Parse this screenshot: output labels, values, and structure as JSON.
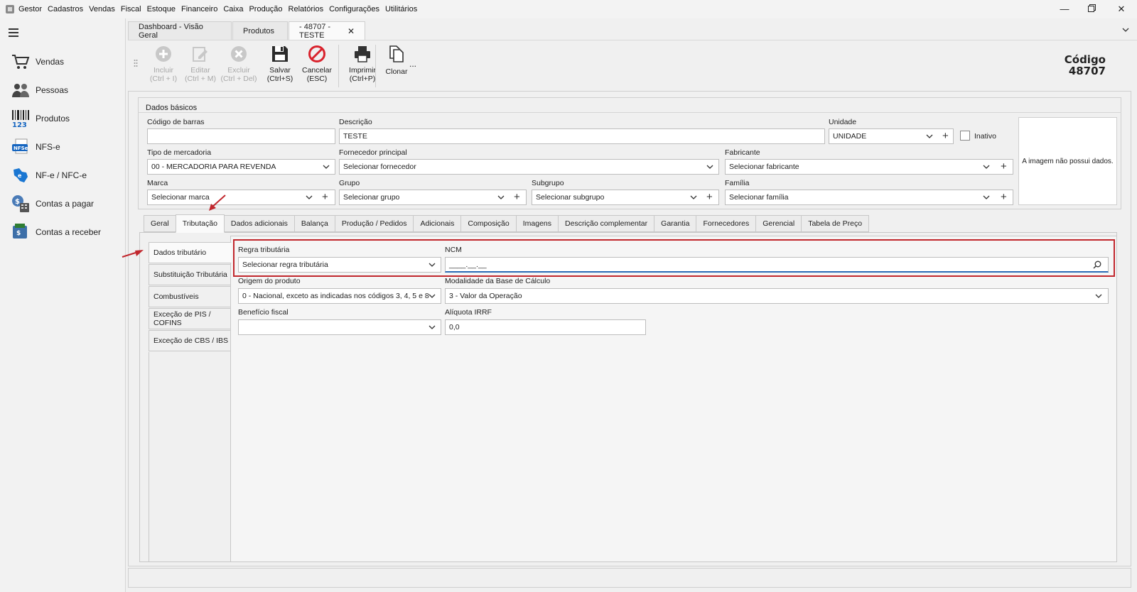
{
  "menubar": {
    "items": [
      "Gestor",
      "Cadastros",
      "Vendas",
      "Fiscal",
      "Estoque",
      "Financeiro",
      "Caixa",
      "Produção",
      "Relatórios",
      "Configurações",
      "Utilitários"
    ]
  },
  "sidebar": {
    "items": [
      {
        "label": "Vendas",
        "icon": "shopping-cart-icon"
      },
      {
        "label": "Pessoas",
        "icon": "people-icon"
      },
      {
        "label": "Produtos",
        "icon": "barcode-icon"
      },
      {
        "label": "NFS-e",
        "icon": "nfse-icon"
      },
      {
        "label": "NF-e / NFC-e",
        "icon": "nfe-icon"
      },
      {
        "label": "Contas a pagar",
        "icon": "bills-icon"
      },
      {
        "label": "Contas a receber",
        "icon": "receivables-icon"
      }
    ]
  },
  "doc_tabs": [
    {
      "label": "Dashboard - Visão Geral"
    },
    {
      "label": "Produtos"
    },
    {
      "label": "- 48707 - TESTE",
      "active": true,
      "close": "✕"
    }
  ],
  "toolbar": {
    "incluir": {
      "l1": "Incluir",
      "l2": "(Ctrl + I)"
    },
    "editar": {
      "l1": "Editar",
      "l2": "(Ctrl + M)"
    },
    "excluir": {
      "l1": "Excluir",
      "l2": "(Ctrl + Del)"
    },
    "salvar": {
      "l1": "Salvar",
      "l2": "(Ctrl+S)"
    },
    "cancelar": {
      "l1": "Cancelar",
      "l2": "(ESC)"
    },
    "imprimir": {
      "l1": "Imprimir",
      "l2": "(Ctrl+P)"
    },
    "clonar": {
      "l1": "Clonar"
    },
    "more": "..."
  },
  "codigo": {
    "label": "Código",
    "value": "48707"
  },
  "dados_basicos": {
    "title": "Dados básicos",
    "codigo_barras": {
      "label": "Código de barras",
      "value": ""
    },
    "descricao": {
      "label": "Descrição",
      "value": "TESTE"
    },
    "unidade": {
      "label": "Unidade",
      "value": "UNIDADE"
    },
    "inativo": {
      "label": "Inativo",
      "checked": false
    },
    "tipo_mercadoria": {
      "label": "Tipo de mercadoria",
      "value": "00 - MERCADORIA PARA REVENDA"
    },
    "fornecedor": {
      "label": "Fornecedor principal",
      "value": "Selecionar fornecedor"
    },
    "fabricante": {
      "label": "Fabricante",
      "value": "Selecionar fabricante"
    },
    "marca": {
      "label": "Marca",
      "value": "Selecionar marca"
    },
    "grupo": {
      "label": "Grupo",
      "value": "Selecionar grupo"
    },
    "subgrupo": {
      "label": "Subgrupo",
      "value": "Selecionar subgrupo"
    },
    "familia": {
      "label": "Família",
      "value": "Selecionar família"
    },
    "image_placeholder": "A imagem não possui dados."
  },
  "inner_tabs": [
    "Geral",
    "Tributação",
    "Dados adicionais",
    "Balança",
    "Produção / Pedidos",
    "Adicionais",
    "Composição",
    "Imagens",
    "Descrição complementar",
    "Garantia",
    "Fornecedores",
    "Gerencial",
    "Tabela de Preço"
  ],
  "side_tabs": [
    "Dados tributário",
    "Substituição Tributária",
    "Combustíveis",
    "Exceção de PIS / COFINS",
    "Exceção de CBS / IBS"
  ],
  "tributario": {
    "regra": {
      "label": "Regra tributária",
      "value": "Selecionar regra tributária"
    },
    "ncm": {
      "label": "NCM",
      "value": "____.__.__"
    },
    "origem": {
      "label": "Origem do produto",
      "value": "0 - Nacional, exceto as indicadas nos códigos 3, 4, 5 e 8"
    },
    "modalidade": {
      "label": "Modalidade da Base de Cálculo",
      "value": "3 - Valor da Operação"
    },
    "beneficio": {
      "label": "Benefício fiscal",
      "value": ""
    },
    "aliquota": {
      "label": "Alíquota IRRF",
      "value": "0,0"
    }
  },
  "colors": {
    "highlight": "#c1272d",
    "disabled_icon": "#c8c8c8",
    "cancel_red": "#d9232d"
  }
}
